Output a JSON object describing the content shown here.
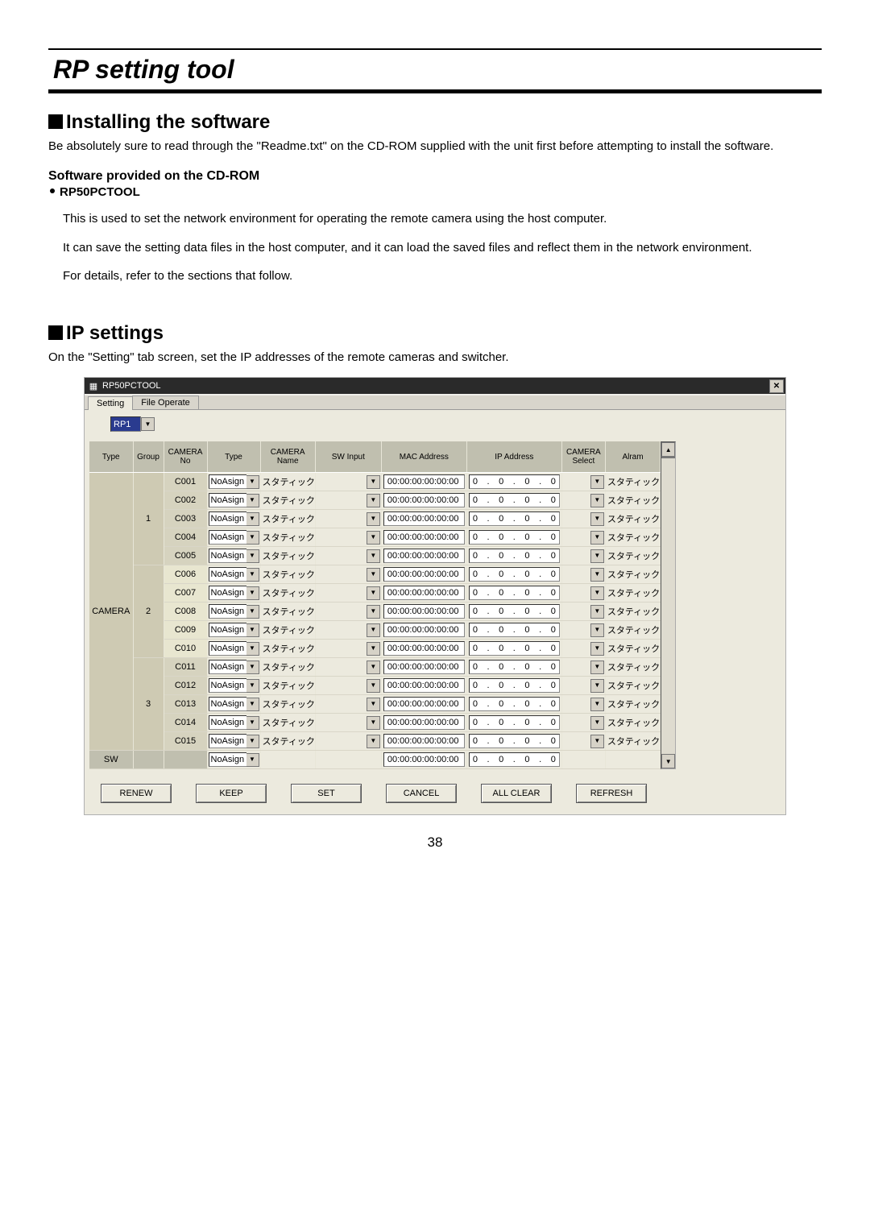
{
  "page_title": "RP setting tool",
  "section1": {
    "heading": "Installing the software",
    "intro": "Be absolutely sure to read through the \"Readme.txt\" on the CD-ROM supplied with the unit first before attempting to install the software.",
    "subhead": "Software provided on the CD-ROM",
    "bullet_name": "RP50PCTOOL",
    "desc1": "This is used to set the network environment for operating the remote camera using the host computer.",
    "desc2": "It can save the setting data files in the host computer, and it can load the saved files and reflect them in the network environment.",
    "desc3": "For details, refer to the sections that follow."
  },
  "section2": {
    "heading": "IP settings",
    "intro": "On the \"Setting\" tab screen, set the IP addresses of the remote cameras and switcher."
  },
  "window": {
    "title": "RP50PCTOOL",
    "tabs": [
      "Setting",
      "File Operate"
    ],
    "top_select_value": "RP1",
    "headers": {
      "type": "Type",
      "group": "Group",
      "camera_no": "CAMERA No",
      "type2": "Type",
      "camera_name": "CAMERA Name",
      "sw_input": "SW Input",
      "mac": "MAC Address",
      "ip": "IP Address",
      "camera_select": "CAMERA Select",
      "alarm": "Alram"
    },
    "camera_label": "CAMERA",
    "sw_label": "SW",
    "type_options": "NoAsign",
    "camname_label": "スタティック",
    "alarm_label": "スタティック",
    "mac_default": "00:00:00:00:00:00",
    "ip_default": [
      "0",
      "0",
      "0",
      "0"
    ],
    "rows": [
      {
        "group": "1",
        "no": "C001"
      },
      {
        "group": "1",
        "no": "C002"
      },
      {
        "group": "1",
        "no": "C003"
      },
      {
        "group": "1",
        "no": "C004"
      },
      {
        "group": "1",
        "no": "C005"
      },
      {
        "group": "2",
        "no": "C006"
      },
      {
        "group": "2",
        "no": "C007"
      },
      {
        "group": "2",
        "no": "C008"
      },
      {
        "group": "2",
        "no": "C009"
      },
      {
        "group": "2",
        "no": "C010"
      },
      {
        "group": "3",
        "no": "C011"
      },
      {
        "group": "3",
        "no": "C012"
      },
      {
        "group": "3",
        "no": "C013"
      },
      {
        "group": "3",
        "no": "C014"
      },
      {
        "group": "3",
        "no": "C015"
      }
    ],
    "buttons": {
      "renew": "RENEW",
      "keep": "KEEP",
      "set": "SET",
      "cancel": "CANCEL",
      "all_clear": "ALL CLEAR",
      "refresh": "REFRESH"
    }
  },
  "page_number": "38"
}
